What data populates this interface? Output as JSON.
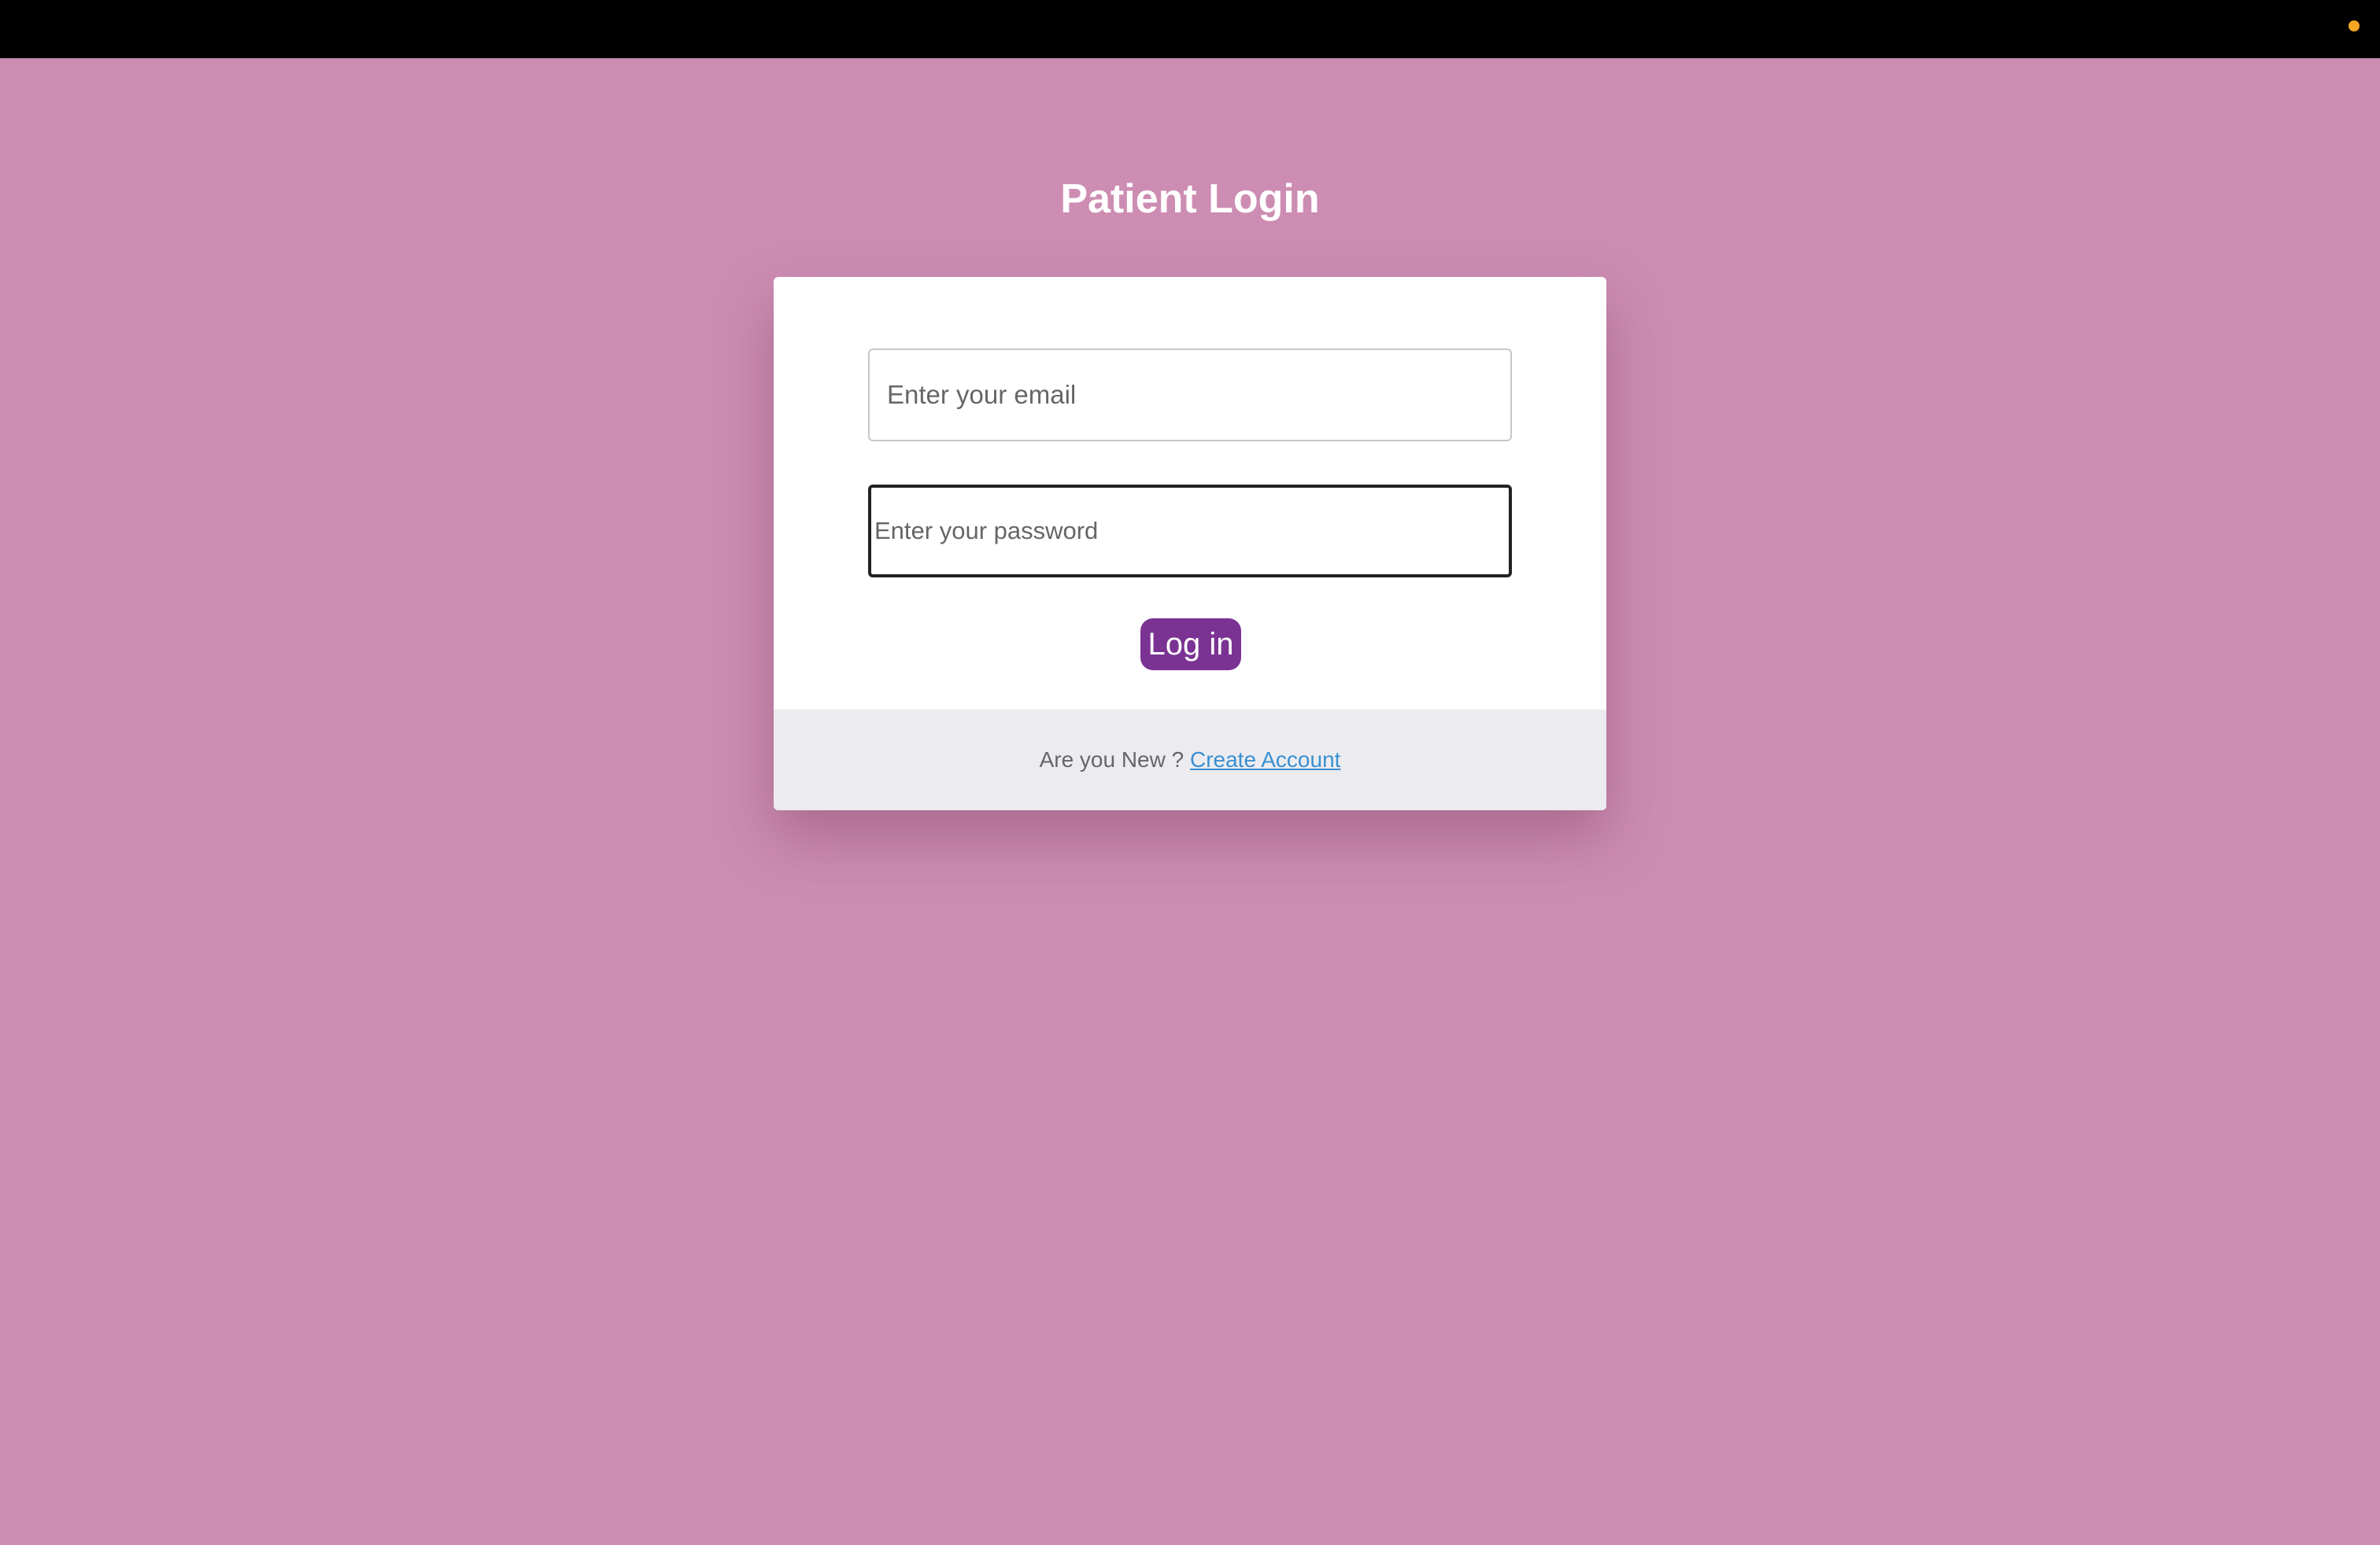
{
  "colors": {
    "background": "#cd8db2",
    "topbar": "#000000",
    "status_dot": "#f5a623",
    "accent": "#7b3393",
    "link": "#3a8fd1",
    "footer_bg": "#ececf0"
  },
  "header": {
    "title": "Patient Login"
  },
  "form": {
    "email_placeholder": "Enter your email",
    "email_value": "",
    "password_placeholder": "Enter your password",
    "password_value": "",
    "login_label": "Log in"
  },
  "footer": {
    "prompt": "Are you New ?",
    "link_label": "Create Account"
  }
}
